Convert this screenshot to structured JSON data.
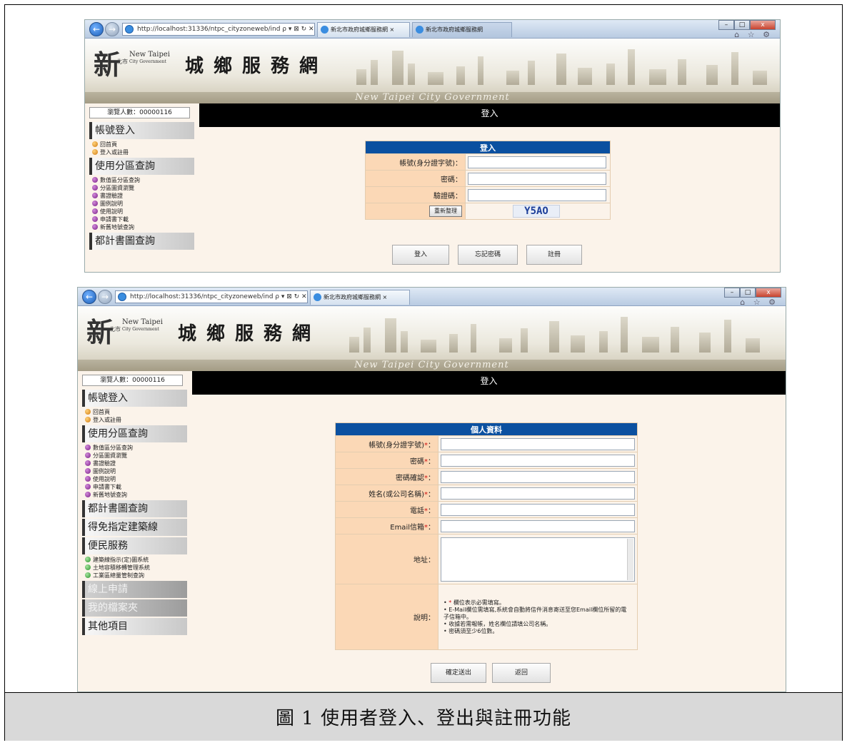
{
  "caption": "圖 1 使用者登入、登出與註冊功能",
  "browser": {
    "url_host": "http://localhost",
    "url1_rest": ":31336/ntpc_cityzoneweb/ind",
    "url2_rest": ":31336/ntpc_cityzoneweb/ind",
    "tab_title": "新北市政府城鄉服務網",
    "win_min": "–",
    "win_max": "□",
    "win_close": "x",
    "tools": "⌂ ☆ ⚙"
  },
  "site": {
    "logo_char": "新",
    "logo_city": "北市",
    "logo_en1": "New Taipei",
    "logo_en2": "City Government",
    "title": "城鄉服務網",
    "gov_en": "New Taipei City Government"
  },
  "sidebar": {
    "visit_count": "瀏覽人數：00000116",
    "account_head": "帳號登入",
    "account_items": [
      "回首頁",
      "登入或註冊"
    ],
    "zoning_head": "使用分區查詢",
    "zoning_items": [
      "數值區分區查詢",
      "分區圖資瀏覽",
      "書證驗證",
      "圖例說明",
      "使用說明",
      "申請書下載",
      "新舊地號查詢"
    ],
    "plan_head": "都計書圖查詢",
    "building_line_head": "得免指定建築線",
    "public_service_head": "便民服務",
    "public_service_items": [
      "建築線指示(定)圖系統",
      "土地容積移轉管理系統",
      "工業區總量管制查詢"
    ],
    "online_apply_head": "線上申請",
    "my_files_head": "我的檔案夾",
    "other_head": "其他項目"
  },
  "login": {
    "title_bar": "登入",
    "form_header": "登入",
    "account_label": "帳號(身分證字號)：",
    "password_label": "密碼：",
    "captcha_label": "驗證碼：",
    "refresh_button": "重新整理",
    "captcha_text": "Y5AO",
    "login_button": "登入",
    "forgot_button": "忘記密碼",
    "register_button": "註冊"
  },
  "register": {
    "title_bar": "登入",
    "form_header": "個人資料",
    "account_label": "帳號(身分證字號)",
    "password_label": "密碼",
    "password_confirm_label": "密碼確認",
    "name_label": "姓名(或公司名稱)",
    "phone_label": "電話",
    "email_label": "Email信箱",
    "address_label": "地址：",
    "notes_label": "說明：",
    "required_mark": "*",
    "colon": "：",
    "notes": [
      {
        "mark": "*",
        "text": "欄位表示必需填寫。"
      },
      {
        "mark": "",
        "text": "E-Mail欄位需填寫,系統會自動將信件消息寄送至您Email欄位所留的電子信箱中。"
      },
      {
        "mark": "",
        "text": "收據若需報帳，姓名欄位請填公司名稱。"
      },
      {
        "mark": "",
        "text": "密碼須至少6位數。"
      }
    ],
    "submit_button": "確定送出",
    "back_button": "返回"
  }
}
